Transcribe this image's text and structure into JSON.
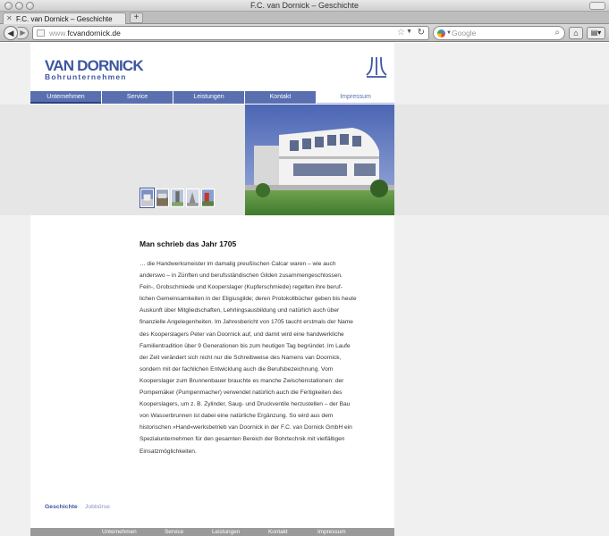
{
  "window": {
    "title": "F.C. van Dornick – Geschichte"
  },
  "tab": {
    "label": "F.C. van Dornick – Geschichte",
    "new_tab_label": "+"
  },
  "toolbar": {
    "url_prefix": "www.",
    "url_rest": "fcvandornick.de",
    "search_placeholder": "Google"
  },
  "logo": {
    "main": "VAN DORNICK",
    "sub": "Bohrunternehmen",
    "brand_color": "#3d56a0"
  },
  "nav": {
    "items": [
      {
        "label": "Unternehmen"
      },
      {
        "label": "Service"
      },
      {
        "label": "Leistungen"
      },
      {
        "label": "Kontakt"
      },
      {
        "label": "Impressum"
      }
    ],
    "active_color": "#5a6fb0"
  },
  "article": {
    "title": "Man schrieb das Jahr 1705",
    "body": "… die Handwerksmeister im damalig preußischen Calcar waren – wie auch anderswo – in Zünften und berufsständischen Gilden zusammengeschlossen. Fein-, Grobschmiede und Kooperslager (Kupferschmiede) regelten ihre beruf- lichen Gemeinsamkeiten in der Eligiusgilde; deren Protokollbücher geben bis heute Auskunft über Mitgliedschaften, Lehrlingsausbildung und natürlich auch über finanzielle Angelegenheiten. Im Jahresbericht von 1705 taucht erstmals der Name des Kooperslagers Peter van Doornick auf, und damit wird eine handwerkliche Familientradition über 9 Generationen bis zum heutigen Tag begründet. Im Laufe der Zeit verändert sich nicht nur die Schreibweise des Namens van Doornick, sondern mit der fachlichen Entwicklung auch die Berufsbezeichnung. Vom Kooperslager zum Brunnenbauer brauchte es manche Zwischenstationen: der Pompemäker (Pumpenmacher) verwendet natürlich auch die Fertigkeiten des Kooperslagers, um z. B. Zylinder, Saug- und Druckventile herzustellen – der Bau von Wasserbrunnen ist dabei eine natürliche Ergänzung. So wird aus dem historischen »Hand«werksbetrieb van Doornick in der F.C. van Dornick GmbH ein Spezialunternehmen für den gesamten Bereich der Bohrtechnik mit vielfältigen Einsatzmöglichkeiten."
  },
  "subnav": {
    "items": [
      {
        "label": "Geschichte"
      },
      {
        "label": "Jobbörse"
      }
    ]
  },
  "footer": {
    "items": [
      {
        "label": "Unternehmen"
      },
      {
        "label": "Service"
      },
      {
        "label": "Leistungen"
      },
      {
        "label": "Kontakt"
      },
      {
        "label": "Impressum"
      }
    ]
  }
}
